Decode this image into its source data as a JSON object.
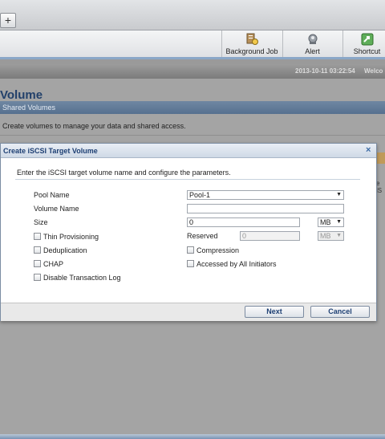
{
  "tabstrip": {
    "add_label": "+"
  },
  "toolbar": {
    "background_job": "Background Job",
    "alert": "Alert",
    "shortcut": "Shortcut"
  },
  "statusbar": {
    "timestamp": "2013-10-11 03:22:54",
    "welcome": "Welco"
  },
  "page": {
    "title": "Volume",
    "breadcrumb": "Shared Volumes",
    "description": "Create volumes to manage your data and shared access.",
    "side_text": "e iS"
  },
  "dialog": {
    "title": "Create iSCSI Target Volume",
    "close": "×",
    "instruction": "Enter the iSCSI target volume name and configure the parameters.",
    "pool_name_label": "Pool Name",
    "pool_name_value": "Pool-1",
    "volume_name_label": "Volume Name",
    "volume_name_value": "",
    "size_label": "Size",
    "size_value": "0",
    "size_unit": "MB",
    "thin_provisioning_label": "Thin Provisioning",
    "reserved_label": "Reserved",
    "reserved_value": "0",
    "reserved_unit": "MB",
    "deduplication_label": "Deduplication",
    "compression_label": "Compression",
    "chap_label": "CHAP",
    "accessed_by_all_label": "Accessed by All Initiators",
    "disable_tlog_label": "Disable Transaction Log",
    "next_label": "Next",
    "cancel_label": "Cancel"
  },
  "colors": {
    "accent": "#1d3f73",
    "breadcrumb_bar": "#5f7894",
    "dim_background": "#a4a4a4"
  }
}
